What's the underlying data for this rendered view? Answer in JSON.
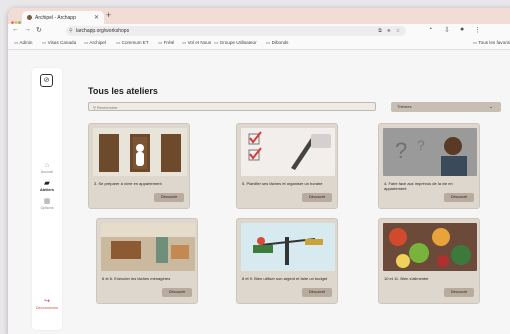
{
  "browser": {
    "tab_title": "Archipel - Archapp",
    "new_tab": "+",
    "url": "larchapp.org/workshops",
    "bookmarks": [
      "Admin",
      "Visas Canada",
      "Archipel",
      "Commum ET",
      "Frété",
      "Vol et Nous",
      "Groupe Utilisateur",
      "Dibonds"
    ],
    "bookmarks_right": "Tous les favoris"
  },
  "sidebar": {
    "items": [
      {
        "label": "Accueil",
        "icon": "home-icon"
      },
      {
        "label": "Ateliers",
        "icon": "book-icon"
      },
      {
        "label": "Options",
        "icon": "calendar-icon"
      }
    ],
    "logout": "Déconnexion"
  },
  "main": {
    "title": "Tous les ateliers",
    "search_placeholder": "Rechercher",
    "filter_label": "Thèmes"
  },
  "cards": [
    {
      "caption": "3. Se préparer à vivre en appartement",
      "button": "Découvrir"
    },
    {
      "caption": "5. Planifier ses tâches et organiser un horaire",
      "button": "Découvrir"
    },
    {
      "caption": "4. Faire face aux imprévus de la vie en appartement",
      "button": "Découvrir"
    },
    {
      "caption": "6 et 6. Exécuter les tâches ménagères",
      "button": "Découvrir"
    },
    {
      "caption": "8 et 9. Bien utiliser son argent et faire un budget",
      "button": "Découvrir"
    },
    {
      "caption": "10 et 11. Bien s'alimenter",
      "button": "Découvrir"
    }
  ],
  "colors": {
    "tabstrip": "#f2dcd6",
    "card_bg": "#ded7ce",
    "button": "#b9ac9e",
    "logout": "#d24b3a"
  }
}
